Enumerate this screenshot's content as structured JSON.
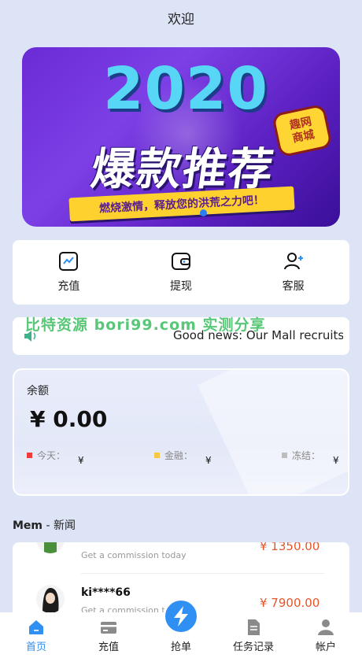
{
  "header": {
    "title": "欢迎"
  },
  "banner": {
    "year": "2020",
    "badge": "趣网\n商城",
    "title": "爆款推荐",
    "slogan": "燃烧激情，释放您的洪荒之力吧！"
  },
  "actions": [
    {
      "label": "充值",
      "icon": "recharge-icon"
    },
    {
      "label": "提现",
      "icon": "wallet-icon"
    },
    {
      "label": "客服",
      "icon": "customer-service-icon"
    }
  ],
  "notice": {
    "text": "Good news: Our Mall recruits or"
  },
  "watermark": "比特资源 bori99.com 实测分享",
  "balance": {
    "label": "余额",
    "amount": "¥ 0.00",
    "today": {
      "label": "今天：",
      "value": "¥",
      "color": "#f13b3b"
    },
    "finance": {
      "label": "金融：",
      "value": "¥",
      "color": "#f6c744"
    },
    "frozen": {
      "label": "冻结：",
      "value": "¥",
      "color": "#bdbdbd"
    }
  },
  "news": {
    "title_bold": "Mem",
    "title_rest": " - 新闻",
    "items": [
      {
        "user": "",
        "desc": "Get a commission today",
        "amount": "¥ 1350.00"
      },
      {
        "user": "ki****66",
        "desc": "Get a commission today",
        "amount": "¥ 7900.00"
      }
    ]
  },
  "tabbar": [
    {
      "label": "首页",
      "icon": "home-icon",
      "active": true
    },
    {
      "label": "充值",
      "icon": "card-icon",
      "active": false
    },
    {
      "label": "抢单",
      "icon": "lightning-icon",
      "active": false
    },
    {
      "label": "任务记录",
      "icon": "document-icon",
      "active": false
    },
    {
      "label": "帐户",
      "icon": "user-icon",
      "active": false
    }
  ],
  "colors": {
    "accent": "#2f8ff3",
    "money": "#e4552a",
    "background": "#dde4f6"
  }
}
